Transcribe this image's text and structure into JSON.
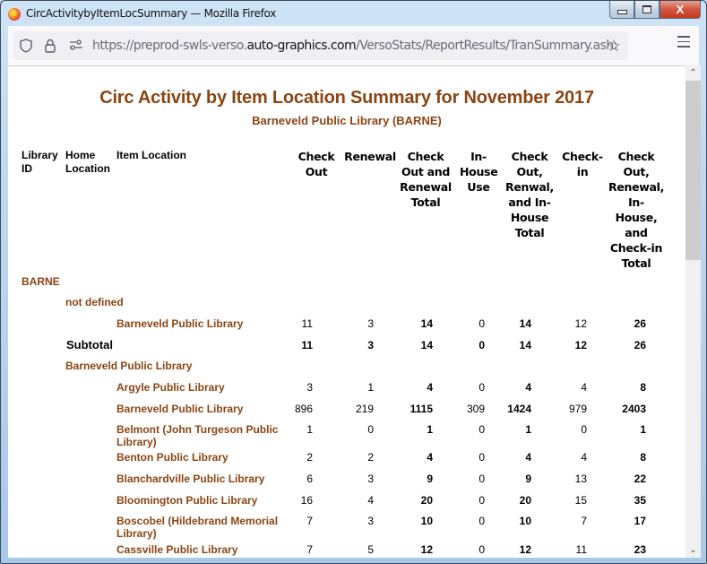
{
  "window": {
    "title": "CircActivitybyItemLocSummary — Mozilla Firefox",
    "controls": {
      "minimize": "minimize",
      "maximize": "maximize",
      "close": "X"
    }
  },
  "navbar": {
    "url_prefix": "https://preprod-swls-verso.",
    "url_host": "auto-graphics.com",
    "url_path": "/VersoStats/ReportResults/TranSummary.ashx?r=FILS",
    "icons": [
      "shield-icon",
      "lock-icon",
      "permissions-icon",
      "bookmark-star-icon",
      "menu-icon"
    ]
  },
  "report": {
    "title": "Circ Activity by Item Location Summary for November 2017",
    "subtitle": "Barneveld Public Library (BARNE)",
    "columns": {
      "library_id": "Library ID",
      "home_location": "Home Location",
      "item_location": "Item Location",
      "check_out": "Check Out",
      "renewal": "Renewal",
      "checkout_renewal_total": "Check Out and Renewal Total",
      "in_house_use": "In-House Use",
      "checkout_renewal_inhouse_total": "Check Out, Renwal, and In-House Total",
      "check_in": "Check-in",
      "grand_total": "Check Out, Renewal, In-House, and Check-in Total"
    },
    "library_id": "BARNE",
    "groups": [
      {
        "home_location": "not defined",
        "rows": [
          {
            "item_location": "Barneveld Public Library",
            "values": [
              11,
              3,
              14,
              0,
              14,
              12,
              26
            ]
          }
        ],
        "subtotal_label": "Subtotal",
        "subtotal": [
          11,
          3,
          14,
          0,
          14,
          12,
          26
        ]
      },
      {
        "home_location": "Barneveld Public Library",
        "rows": [
          {
            "item_location": "Argyle Public Library",
            "values": [
              3,
              1,
              4,
              0,
              4,
              4,
              8
            ]
          },
          {
            "item_location": "Barneveld Public Library",
            "values": [
              896,
              219,
              1115,
              309,
              1424,
              979,
              2403
            ]
          },
          {
            "item_location": "Belmont (John Turgeson Public Library)",
            "values": [
              1,
              0,
              1,
              0,
              1,
              0,
              1
            ]
          },
          {
            "item_location": "Benton Public Library",
            "values": [
              2,
              2,
              4,
              0,
              4,
              4,
              8
            ]
          },
          {
            "item_location": "Blanchardville Public Library",
            "values": [
              6,
              3,
              9,
              0,
              9,
              13,
              22
            ]
          },
          {
            "item_location": "Bloomington Public Library",
            "values": [
              16,
              4,
              20,
              0,
              20,
              15,
              35
            ]
          },
          {
            "item_location": "Boscobel (Hildebrand Memorial Library)",
            "values": [
              7,
              3,
              10,
              0,
              10,
              7,
              17
            ]
          },
          {
            "item_location": "Cassville Public Library",
            "values": [
              7,
              5,
              12,
              0,
              12,
              11,
              23
            ]
          }
        ]
      }
    ]
  },
  "colors": {
    "brand_brown": "#8b4513",
    "close_button": "#c23a22"
  }
}
